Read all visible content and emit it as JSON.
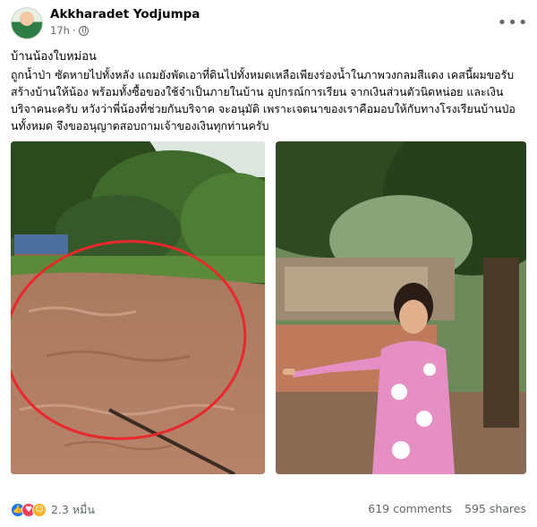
{
  "post": {
    "author": "Akkharadet Yodjumpa",
    "time": "17h",
    "title": "บ้านน้องใบหม่อน",
    "body": "ถูกน้ำป่า ซัดหายไปทั้งหลัง แถมยังพัดเอาที่ดินไปทั้งหมดเหลือเพียงร่องน้ำในภาพวงกลมสีแดง เคสนี้ผมขอรับสร้างบ้านให้น้อง พร้อมทั้งซื้อของใช้จำเป็นภายในบ้าน อุปกรณ์การเรียน จากเงินส่วนตัวนิดหน่อย และเงินบริจาคนะครับ หวังว่าพี่น้องที่ช่วยกันบริจาค จะอนุมัติ เพราะเจตนาของเราคือมอบให้กับทางโรงเรียนบ้านป่อนทั้งหมด จึงขออนุญาตสอบถามเจ้าของเงินทุกท่านครับ"
  },
  "reactions": {
    "count": "2.3 หมื่น",
    "icons": [
      "like-icon",
      "love-icon",
      "care-icon"
    ],
    "colors": {
      "like": "#1877f2",
      "love": "#f33e58",
      "care": "#f7b125"
    }
  },
  "stats": {
    "comments": "619 comments",
    "shares": "595 shares"
  },
  "colors": {
    "secondary_text": "#65676b",
    "circle": "#e8282a"
  }
}
